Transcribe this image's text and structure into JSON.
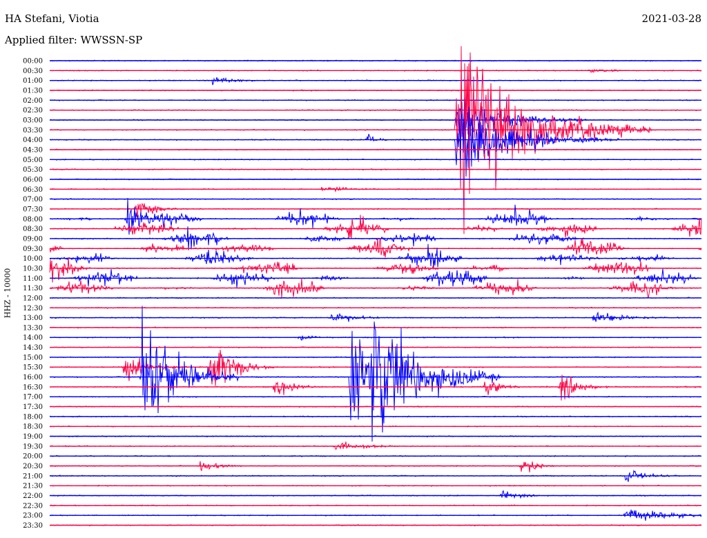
{
  "header": {
    "station": "HA Stefani, Viotia",
    "date": "2021-03-28",
    "filter": "Applied filter: WWSSN-SP"
  },
  "chart_data": {
    "type": "line",
    "title": "HA Stefani, Viotia",
    "subtitle": "Applied filter: WWSSN-SP",
    "ylabel": "HHZ - 10000",
    "time_labels": [
      "00:00",
      "00:30",
      "01:00",
      "01:30",
      "02:00",
      "02:30",
      "03:00",
      "03:30",
      "04:00",
      "04:30",
      "05:00",
      "05:30",
      "06:00",
      "06:30",
      "07:00",
      "07:30",
      "08:00",
      "08:30",
      "09:00",
      "09:30",
      "10:00",
      "10:30",
      "11:00",
      "11:30",
      "12:00",
      "12:30",
      "13:00",
      "13:30",
      "14:00",
      "14:30",
      "15:00",
      "15:30",
      "16:00",
      "16:30",
      "17:00",
      "17:30",
      "18:00",
      "18:30",
      "19:00",
      "19:30",
      "20:00",
      "20:30",
      "21:00",
      "21:30",
      "22:00",
      "22:30",
      "23:00",
      "23:30"
    ],
    "trace_colors": [
      "#0000ff",
      "#ff0044"
    ],
    "trace_minutes": 30,
    "events": [
      {
        "row": 7,
        "minute": 18.7,
        "amplitude": 9.0,
        "duration": 3.0
      },
      {
        "row": 8,
        "minute": 18.7,
        "amplitude": 4.0,
        "duration": 2.5
      },
      {
        "row": 6,
        "minute": 18.7,
        "amplitude": 3.0,
        "duration": 2.0
      },
      {
        "row": 8,
        "minute": 14.6,
        "amplitude": 0.9,
        "duration": 0.4
      },
      {
        "row": 2,
        "minute": 7.5,
        "amplitude": 0.35,
        "duration": 1.5
      },
      {
        "row": 1,
        "minute": 24.8,
        "amplitude": 0.3,
        "duration": 1.0
      },
      {
        "row": 13,
        "minute": 12.5,
        "amplitude": 0.35,
        "duration": 1.5
      },
      {
        "row": 15,
        "minute": 4.0,
        "amplitude": 1.2,
        "duration": 0.8
      },
      {
        "row": 16,
        "minute": 3.5,
        "amplitude": 2.0,
        "duration": 1.0
      },
      {
        "row": 31,
        "minute": 3.4,
        "amplitude": 1.6,
        "duration": 1.0
      },
      {
        "row": 32,
        "minute": 4.2,
        "amplitude": 7.0,
        "duration": 1.5
      },
      {
        "row": 31,
        "minute": 7.4,
        "amplitude": 3.5,
        "duration": 1.0
      },
      {
        "row": 32,
        "minute": 13.8,
        "amplitude": 6.0,
        "duration": 1.5
      },
      {
        "row": 32,
        "minute": 14.8,
        "amplitude": 9.0,
        "duration": 2.0
      },
      {
        "row": 32,
        "minute": 17.4,
        "amplitude": 1.0,
        "duration": 0.8
      },
      {
        "row": 33,
        "minute": 10.3,
        "amplitude": 1.2,
        "duration": 0.8
      },
      {
        "row": 33,
        "minute": 20.0,
        "amplitude": 1.0,
        "duration": 0.8
      },
      {
        "row": 33,
        "minute": 23.5,
        "amplitude": 1.5,
        "duration": 0.8
      },
      {
        "row": 39,
        "minute": 13.1,
        "amplitude": 0.5,
        "duration": 1.5
      },
      {
        "row": 41,
        "minute": 6.9,
        "amplitude": 0.7,
        "duration": 0.8
      },
      {
        "row": 41,
        "minute": 21.7,
        "amplitude": 1.1,
        "duration": 0.6
      },
      {
        "row": 42,
        "minute": 26.5,
        "amplitude": 0.6,
        "duration": 1.2
      },
      {
        "row": 44,
        "minute": 20.8,
        "amplitude": 0.6,
        "duration": 0.8
      },
      {
        "row": 46,
        "minute": 26.5,
        "amplitude": 0.8,
        "duration": 2.0
      },
      {
        "row": 26,
        "minute": 12.9,
        "amplitude": 0.6,
        "duration": 1.2
      },
      {
        "row": 26,
        "minute": 25.0,
        "amplitude": 0.6,
        "duration": 1.5
      },
      {
        "row": 28,
        "minute": 11.5,
        "amplitude": 0.3,
        "duration": 1.0
      }
    ],
    "noisy_rows": [
      16,
      17,
      18,
      19,
      20,
      21,
      22,
      23
    ]
  }
}
